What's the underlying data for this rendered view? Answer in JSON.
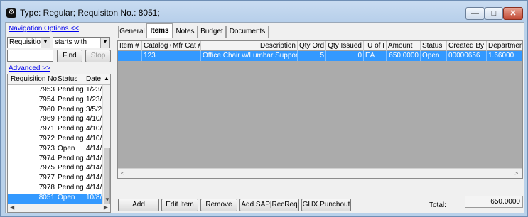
{
  "window": {
    "title": "Type: Regular; Requisiton No.: 8051;",
    "minimize_glyph": "—",
    "maximize_glyph": "□",
    "close_glyph": "✕"
  },
  "nav": {
    "options_link": "Navigation Options <<",
    "field_select": "Requisition No.",
    "operator_select": "starts with",
    "search_value": "",
    "find_label": "Find",
    "stop_label": "Stop",
    "advanced_link": "Advanced >>",
    "columns": [
      "Requisition No.",
      "Status",
      "Date"
    ],
    "rows": [
      {
        "no": "7953",
        "status": "Pending",
        "date": "1/23/"
      },
      {
        "no": "7954",
        "status": "Pending",
        "date": "1/23/"
      },
      {
        "no": "7960",
        "status": "Pending",
        "date": "3/5/2"
      },
      {
        "no": "7969",
        "status": "Pending",
        "date": "4/10/"
      },
      {
        "no": "7971",
        "status": "Pending",
        "date": "4/10/"
      },
      {
        "no": "7972",
        "status": "Pending",
        "date": "4/10/"
      },
      {
        "no": "7973",
        "status": "Open",
        "date": "4/14/"
      },
      {
        "no": "7974",
        "status": "Pending",
        "date": "4/14/"
      },
      {
        "no": "7975",
        "status": "Pending",
        "date": "4/14/"
      },
      {
        "no": "7977",
        "status": "Pending",
        "date": "4/14/"
      },
      {
        "no": "7978",
        "status": "Pending",
        "date": "4/14/"
      },
      {
        "no": "8051",
        "status": "Open",
        "date": "10/8/"
      }
    ],
    "selected_row": "8051"
  },
  "tabs": [
    "General",
    "Items",
    "Notes",
    "Budget",
    "Documents"
  ],
  "active_tab": "Items",
  "items_grid": {
    "columns": [
      "Item #",
      "Catalog #",
      "Mfr Cat #",
      "Description",
      "Qty Ord",
      "Qty Issued",
      "U of I",
      "Amount",
      "Status",
      "Created By",
      "Department"
    ],
    "rows": [
      {
        "item_no": "",
        "catalog_no": "123",
        "mfr_cat_no": "",
        "description": "Office Chair w/Lumbar Support",
        "qty_ord": "5",
        "qty_issued": "0",
        "uoi": "EA",
        "amount": "650.0000",
        "status": "Open",
        "created_by": "00000656",
        "department": "1.66000"
      }
    ]
  },
  "actions": {
    "add": "Add",
    "edit_item": "Edit Item",
    "remove": "Remove",
    "add_sap": "Add SAP|RecReq",
    "ghx_punchout": "GHX Punchout"
  },
  "total": {
    "label": "Total:",
    "value": "650.0000"
  },
  "colors": {
    "selection": "#3399ff",
    "frame": "#b9d1ea"
  }
}
